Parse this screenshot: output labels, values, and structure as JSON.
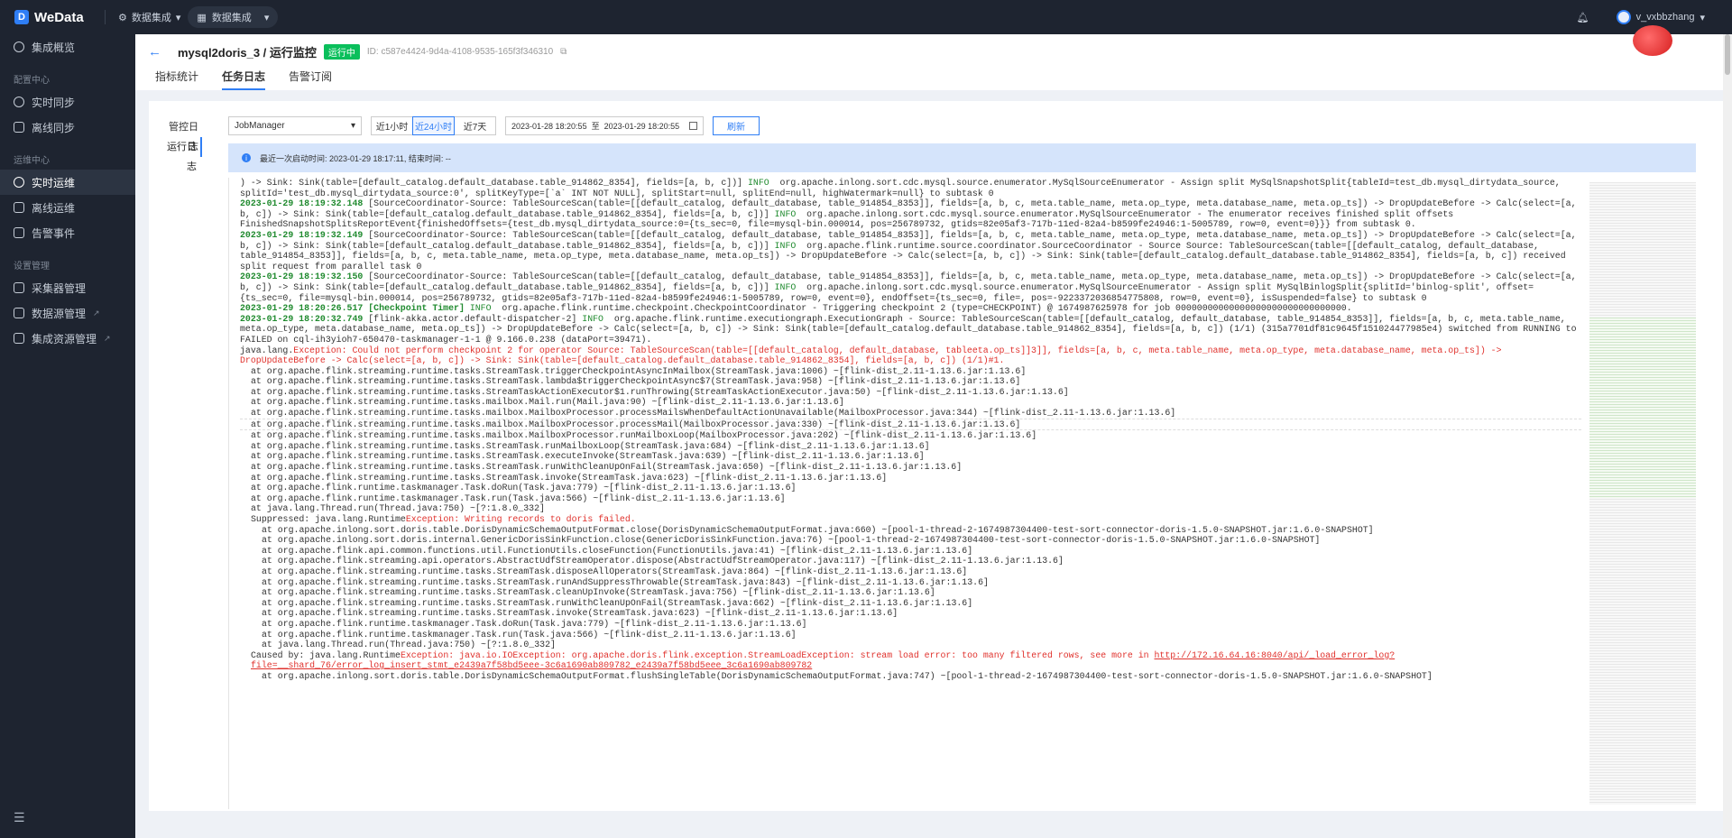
{
  "app": {
    "logo": "WeData",
    "menu1": "数据集成",
    "menu2": "数据集成"
  },
  "user": {
    "name": "v_vxbbzhang"
  },
  "sidebar": {
    "overview": "集成概览",
    "group_config": "配置中心",
    "realtime_sync": "实时同步",
    "offline_sync": "离线同步",
    "group_ops": "运维中心",
    "realtime_ops": "实时运维",
    "offline_ops": "离线运维",
    "alert": "告警事件",
    "group_settings": "设置管理",
    "collector": "采集器管理",
    "datasource": "数据源管理",
    "resource": "集成资源管理",
    "collapse": "☰"
  },
  "header": {
    "title": "mysql2doris_3 / 运行监控",
    "status": "运行中",
    "job_id": "ID: c587e4424-9d4a-4108-9535-165f3f346310",
    "tabs": [
      "指标统计",
      "任务日志",
      "告警订阅"
    ]
  },
  "panel": {
    "left_tabs": [
      "管控日志",
      "运行日志"
    ],
    "select": "JobManager",
    "ranges": [
      "近1小时",
      "近24小时",
      "近7天"
    ],
    "date_from": "2023-01-28 18:20:55",
    "date_sep": "至",
    "date_to": "2023-01-29 18:20:55",
    "refresh": "刷新",
    "info": "最近一次启动时间:  2023-01-29 18:17:11,  结束时间:  --"
  },
  "log": [
    {
      "c": "",
      "t": ") -> Sink: Sink(table=[default_catalog.default_database.table_914862_8354], fields=[a, b, c])] "
    },
    {
      "c": "info",
      "t": "INFO  "
    },
    {
      "c": "",
      "t": "org.apache.inlong.sort.cdc.mysql.source.enumerator.MySqlSourceEnumerator - Assign split MySqlSnapshotSplit{tableId=test_db.mysql_dirtydata_source, splitId='test_db.mysql_dirtydata_source:0', splitKeyType=[`a` INT NOT NULL], splitStart=null, splitEnd=null, highWatermark=null} to subtask 0\n"
    },
    {
      "c": "ts",
      "t": "2023-01-29 18:19:32.148 "
    },
    {
      "c": "",
      "t": "[SourceCoordinator-Source: TableSourceScan(table=[[default_catalog, default_database, table_914854_8353]], fields=[a, b, c, meta.table_name, meta.op_type, meta.database_name, meta.op_ts]) -> DropUpdateBefore -> Calc(select=[a, b, c]) -> Sink: Sink(table=[default_catalog.default_database.table_914862_8354], fields=[a, b, c])] "
    },
    {
      "c": "info",
      "t": "INFO  "
    },
    {
      "c": "",
      "t": "org.apache.inlong.sort.cdc.mysql.source.enumerator.MySqlSourceEnumerator - The enumerator receives finished split offsets FinishedSnapshotSplitsReportEvent{finishedOffsets={test_db.mysql_dirtydata_source:0={ts_sec=0, file=mysql-bin.000014, pos=256789732, gtids=82e05af3-717b-11ed-82a4-b8599fe24946:1-5005789, row=0, event=0}}} from subtask 0.\n"
    },
    {
      "c": "ts",
      "t": "2023-01-29 18:19:32.149 "
    },
    {
      "c": "",
      "t": "[SourceCoordinator-Source: TableSourceScan(table=[[default_catalog, default_database, table_914854_8353]], fields=[a, b, c, meta.table_name, meta.op_type, meta.database_name, meta.op_ts]) -> DropUpdateBefore -> Calc(select=[a, b, c]) -> Sink: Sink(table=[default_catalog.default_database.table_914862_8354], fields=[a, b, c])] "
    },
    {
      "c": "info",
      "t": "INFO  "
    },
    {
      "c": "",
      "t": "org.apache.flink.runtime.source.coordinator.SourceCoordinator - Source Source: TableSourceScan(table=[[default_catalog, default_database, table_914854_8353]], fields=[a, b, c, meta.table_name, meta.op_type, meta.database_name, meta.op_ts]) -> DropUpdateBefore -> Calc(select=[a, b, c]) -> Sink: Sink(table=[default_catalog.default_database.table_914862_8354], fields=[a, b, c]) received split request from parallel task 0\n"
    },
    {
      "c": "ts",
      "t": "2023-01-29 18:19:32.150 "
    },
    {
      "c": "",
      "t": "[SourceCoordinator-Source: TableSourceScan(table=[[default_catalog, default_database, table_914854_8353]], fields=[a, b, c, meta.table_name, meta.op_type, meta.database_name, meta.op_ts]) -> DropUpdateBefore -> Calc(select=[a, b, c]) -> Sink: Sink(table=[default_catalog.default_database.table_914862_8354], fields=[a, b, c])] "
    },
    {
      "c": "info",
      "t": "INFO  "
    },
    {
      "c": "",
      "t": "org.apache.inlong.sort.cdc.mysql.source.enumerator.MySqlSourceEnumerator - Assign split MySqlBinlogSplit{splitId='binlog-split', offset={ts_sec=0, file=mysql-bin.000014, pos=256789732, gtids=82e05af3-717b-11ed-82a4-b8599fe24946:1-5005789, row=0, event=0}, endOffset={ts_sec=0, file=, pos=-9223372036854775808, row=0, event=0}, isSuspended=false} to subtask 0\n"
    },
    {
      "c": "ts",
      "t": "2023-01-29 18:20:26.517 [Checkpoint Timer] "
    },
    {
      "c": "info",
      "t": "INFO  "
    },
    {
      "c": "",
      "t": "org.apache.flink.runtime.checkpoint.CheckpointCoordinator - Triggering checkpoint 2 (type=CHECKPOINT) @ 1674987625978 for job 00000000000000000000000000000000.\n"
    },
    {
      "c": "ts",
      "t": "2023-01-29 18:20:32.749 "
    },
    {
      "c": "",
      "t": "[flink-akka.actor.default-dispatcher-2] "
    },
    {
      "c": "info",
      "t": "INFO  "
    },
    {
      "c": "",
      "t": "org.apache.flink.runtime.executiongraph.ExecutionGraph - Source: TableSourceScan(table=[[default_catalog, default_database, table_914854_8353]], fields=[a, b, c, meta.table_name, meta.op_type, meta.database_name, meta.op_ts]) -> DropUpdateBefore -> Calc(select=[a, b, c]) -> Sink: Sink(table=[default_catalog.default_database.table_914862_8354], fields=[a, b, c]) (1/1) (315a7701df81c9645f151024477985e4) switched from RUNNING to FAILED on cql-ih3yioh7-650470-taskmanager-1-1 @ 9.166.0.238 (dataPort=39471).\n"
    },
    {
      "c": "",
      "t": "java.lang."
    },
    {
      "c": "err",
      "t": "Exception: Could not perform checkpoint 2 for operator Source: TableSourceScan(table=[[default_catalog, default_database, tableeta.op_ts]]3]], fields=[a, b, c, meta.table_name, meta.op_type, meta.database_name, meta.op_ts]) -> DropUpdateBefore -> Calc(select=[a, b, c]) -> Sink: Sink(table=[default_catalog.default_database.table_914862_8354], fields=[a, b, c]) (1/1)#1.\n"
    }
  ],
  "stack1": [
    "at org.apache.flink.streaming.runtime.tasks.StreamTask.triggerCheckpointAsyncInMailbox(StreamTask.java:1006) ~[flink-dist_2.11-1.13.6.jar:1.13.6]",
    "at org.apache.flink.streaming.runtime.tasks.StreamTask.lambda$triggerCheckpointAsync$7(StreamTask.java:958) ~[flink-dist_2.11-1.13.6.jar:1.13.6]",
    "at org.apache.flink.streaming.runtime.tasks.StreamTaskActionExecutor$1.runThrowing(StreamTaskActionExecutor.java:50) ~[flink-dist_2.11-1.13.6.jar:1.13.6]",
    "at org.apache.flink.streaming.runtime.tasks.mailbox.Mail.run(Mail.java:90) ~[flink-dist_2.11-1.13.6.jar:1.13.6]",
    "at org.apache.flink.streaming.runtime.tasks.mailbox.MailboxProcessor.processMailsWhenDefaultActionUnavailable(MailboxProcessor.java:344) ~[flink-dist_2.11-1.13.6.jar:1.13.6]",
    "at org.apache.flink.streaming.runtime.tasks.mailbox.MailboxProcessor.processMail(MailboxProcessor.java:330) ~[flink-dist_2.11-1.13.6.jar:1.13.6]",
    "at org.apache.flink.streaming.runtime.tasks.mailbox.MailboxProcessor.runMailboxLoop(MailboxProcessor.java:202) ~[flink-dist_2.11-1.13.6.jar:1.13.6]",
    "at org.apache.flink.streaming.runtime.tasks.StreamTask.runMailboxLoop(StreamTask.java:684) ~[flink-dist_2.11-1.13.6.jar:1.13.6]",
    "at org.apache.flink.streaming.runtime.tasks.StreamTask.executeInvoke(StreamTask.java:639) ~[flink-dist_2.11-1.13.6.jar:1.13.6]",
    "at org.apache.flink.streaming.runtime.tasks.StreamTask.runWithCleanUpOnFail(StreamTask.java:650) ~[flink-dist_2.11-1.13.6.jar:1.13.6]",
    "at org.apache.flink.streaming.runtime.tasks.StreamTask.invoke(StreamTask.java:623) ~[flink-dist_2.11-1.13.6.jar:1.13.6]",
    "at org.apache.flink.runtime.taskmanager.Task.doRun(Task.java:779) ~[flink-dist_2.11-1.13.6.jar:1.13.6]",
    "at org.apache.flink.runtime.taskmanager.Task.run(Task.java:566) ~[flink-dist_2.11-1.13.6.jar:1.13.6]",
    "at java.lang.Thread.run(Thread.java:750) ~[?:1.8.0_332]"
  ],
  "suppressed": {
    "prefix": "Suppressed: java.lang.Runtime",
    "err": "Exception: Writing records to doris failed."
  },
  "stack2": [
    "at org.apache.inlong.sort.doris.table.DorisDynamicSchemaOutputFormat.close(DorisDynamicSchemaOutputFormat.java:660) ~[pool-1-thread-2-1674987304400-test-sort-connector-doris-1.5.0-SNAPSHOT.jar:1.6.0-SNAPSHOT]",
    "at org.apache.inlong.sort.doris.internal.GenericDorisSinkFunction.close(GenericDorisSinkFunction.java:76) ~[pool-1-thread-2-1674987304400-test-sort-connector-doris-1.5.0-SNAPSHOT.jar:1.6.0-SNAPSHOT]",
    "at org.apache.flink.api.common.functions.util.FunctionUtils.closeFunction(FunctionUtils.java:41) ~[flink-dist_2.11-1.13.6.jar:1.13.6]",
    "at org.apache.flink.streaming.api.operators.AbstractUdfStreamOperator.dispose(AbstractUdfStreamOperator.java:117) ~[flink-dist_2.11-1.13.6.jar:1.13.6]",
    "at org.apache.flink.streaming.runtime.tasks.StreamTask.disposeAllOperators(StreamTask.java:864) ~[flink-dist_2.11-1.13.6.jar:1.13.6]",
    "at org.apache.flink.streaming.runtime.tasks.StreamTask.runAndSuppressThrowable(StreamTask.java:843) ~[flink-dist_2.11-1.13.6.jar:1.13.6]",
    "at org.apache.flink.streaming.runtime.tasks.StreamTask.cleanUpInvoke(StreamTask.java:756) ~[flink-dist_2.11-1.13.6.jar:1.13.6]",
    "at org.apache.flink.streaming.runtime.tasks.StreamTask.runWithCleanUpOnFail(StreamTask.java:662) ~[flink-dist_2.11-1.13.6.jar:1.13.6]",
    "at org.apache.flink.streaming.runtime.tasks.StreamTask.invoke(StreamTask.java:623) ~[flink-dist_2.11-1.13.6.jar:1.13.6]",
    "at org.apache.flink.runtime.taskmanager.Task.doRun(Task.java:779) ~[flink-dist_2.11-1.13.6.jar:1.13.6]",
    "at org.apache.flink.runtime.taskmanager.Task.run(Task.java:566) ~[flink-dist_2.11-1.13.6.jar:1.13.6]",
    "at java.lang.Thread.run(Thread.java:750) ~[?:1.8.0_332]"
  ],
  "caused": {
    "prefix": "Caused by: java.lang.Runtime",
    "err": "Exception: java.io.IOException: org.apache.doris.flink.exception.StreamLoadException: stream load error: too many filtered rows, see more in ",
    "url": "http://172.16.64.16:8040/api/_load_error_log?file=__shard_76/error_log_insert_stmt_e2439a7f58bd5eee-3c6a1690ab809782_e2439a7f58bd5eee_3c6a1690ab809782"
  },
  "last_line": "at org.apache.inlong.sort.doris.table.DorisDynamicSchemaOutputFormat.flushSingleTable(DorisDynamicSchemaOutputFormat.java:747) ~[pool-1-thread-2-1674987304400-test-sort-connector-doris-1.5.0-SNAPSHOT.jar:1.6.0-SNAPSHOT]"
}
